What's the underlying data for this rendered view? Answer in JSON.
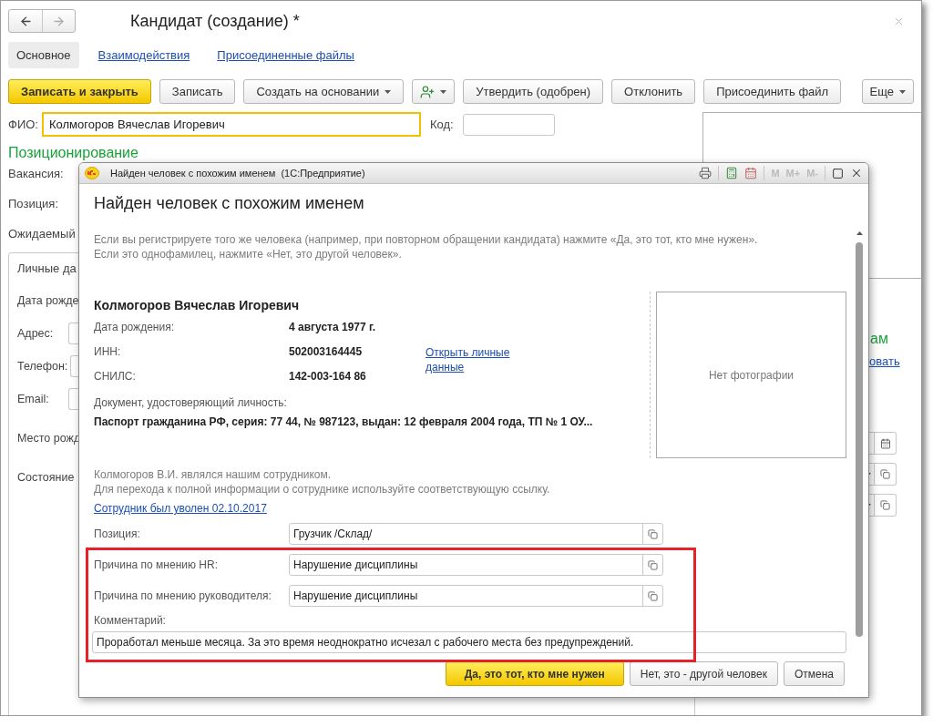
{
  "window": {
    "title": "Кандидат (создание) *"
  },
  "tabs": [
    {
      "label": "Основное",
      "selected": true
    },
    {
      "label": "Взаимодействия",
      "selected": false
    },
    {
      "label": "Присоединенные файлы",
      "selected": false
    }
  ],
  "toolbar": {
    "buttons": [
      {
        "kind": "primary",
        "label": "Записать и закрыть"
      },
      {
        "kind": "plain",
        "label": "Записать"
      },
      {
        "kind": "menu",
        "label": "Создать на основании"
      },
      {
        "kind": "icon-menu"
      },
      {
        "kind": "plain",
        "label": "Утвердить (одобрен)"
      },
      {
        "kind": "plain",
        "label": "Отклонить"
      },
      {
        "kind": "plain",
        "label": "Присоединить файл"
      }
    ],
    "more": "Еще"
  },
  "fio": {
    "label": "ФИО:",
    "value": "Колмогоров Вячеслав Игоревич"
  },
  "code": {
    "label": "Код:"
  },
  "positioning": {
    "heading": "Позиционирование",
    "labels": [
      "Вакансия:",
      "Позиция:",
      "Ожидаемый"
    ]
  },
  "personal_group": {
    "title": "Личные да",
    "rows": [
      {
        "kind": "label",
        "label": "Дата рожде"
      },
      {
        "kind": "field",
        "label": "Адрес:"
      },
      {
        "kind": "field",
        "label": "Телефон:"
      },
      {
        "kind": "field",
        "label": "Email:"
      },
      {
        "kind": "label",
        "label": "Место рожд"
      },
      {
        "kind": "label",
        "label": "Состояние"
      }
    ]
  },
  "right_edge": {
    "heading": "ам",
    "link": "овать",
    "fields": [
      {
        "kind": "date"
      },
      {
        "kind": "select"
      },
      {
        "kind": "select"
      }
    ]
  },
  "dialog": {
    "title": "Найден человек с похожим именем  (1С:Предприятие)",
    "memory_keys": [
      "M",
      "M+",
      "M-"
    ],
    "heading": "Найден человек с похожим именем",
    "intro": [
      "Если вы регистрируете того же человека (например, при повторном обращении кандидата) нажмите «Да, это тот, кто мне нужен».",
      "Если это однофамилец, нажмите «Нет, это другой человек»."
    ],
    "person": {
      "name": "Колмогоров Вячеслав Игоревич",
      "rows": [
        {
          "label": "Дата рождения:",
          "value": "4 августа 1977 г."
        },
        {
          "label": "ИНН:",
          "value": "502003164445"
        },
        {
          "label": "СНИЛС:",
          "value": "142-003-164 86"
        }
      ],
      "open_link": "Открыть личные данные",
      "document_label": "Документ, удостоверяющий личность:",
      "document": "Паспорт гражданина РФ, серия: 77 44, № 987123, выдан: 12 февраля 2004 года, ТП № 1 ОУ...",
      "photo_placeholder": "Нет фотографии"
    },
    "employee": {
      "note": [
        "Колмогоров В.И. являлся нашим сотрудником.",
        "Для перехода к полной информации о сотруднике используйте соответствующую ссылку."
      ],
      "link": "Сотрудник был уволен 02.10.2017"
    },
    "fields": [
      {
        "label": "Позиция:",
        "value": "Грузчик /Склад/"
      },
      {
        "label": "Причина по мнению HR:",
        "value": "Нарушение дисциплины"
      },
      {
        "label": "Причина по мнению руководителя:",
        "value": "Нарушение дисциплины"
      }
    ],
    "comment": {
      "label": "Комментарий:",
      "value": "Проработал меньше месяца. За это время неоднократно исчезал с рабочего места без предупреждений."
    },
    "buttons": [
      {
        "kind": "default",
        "label": "Да, это тот, кто мне нужен"
      },
      {
        "kind": "plain",
        "label": "Нет, это - другой человек"
      },
      {
        "kind": "plain",
        "label": "Отмена"
      }
    ]
  }
}
